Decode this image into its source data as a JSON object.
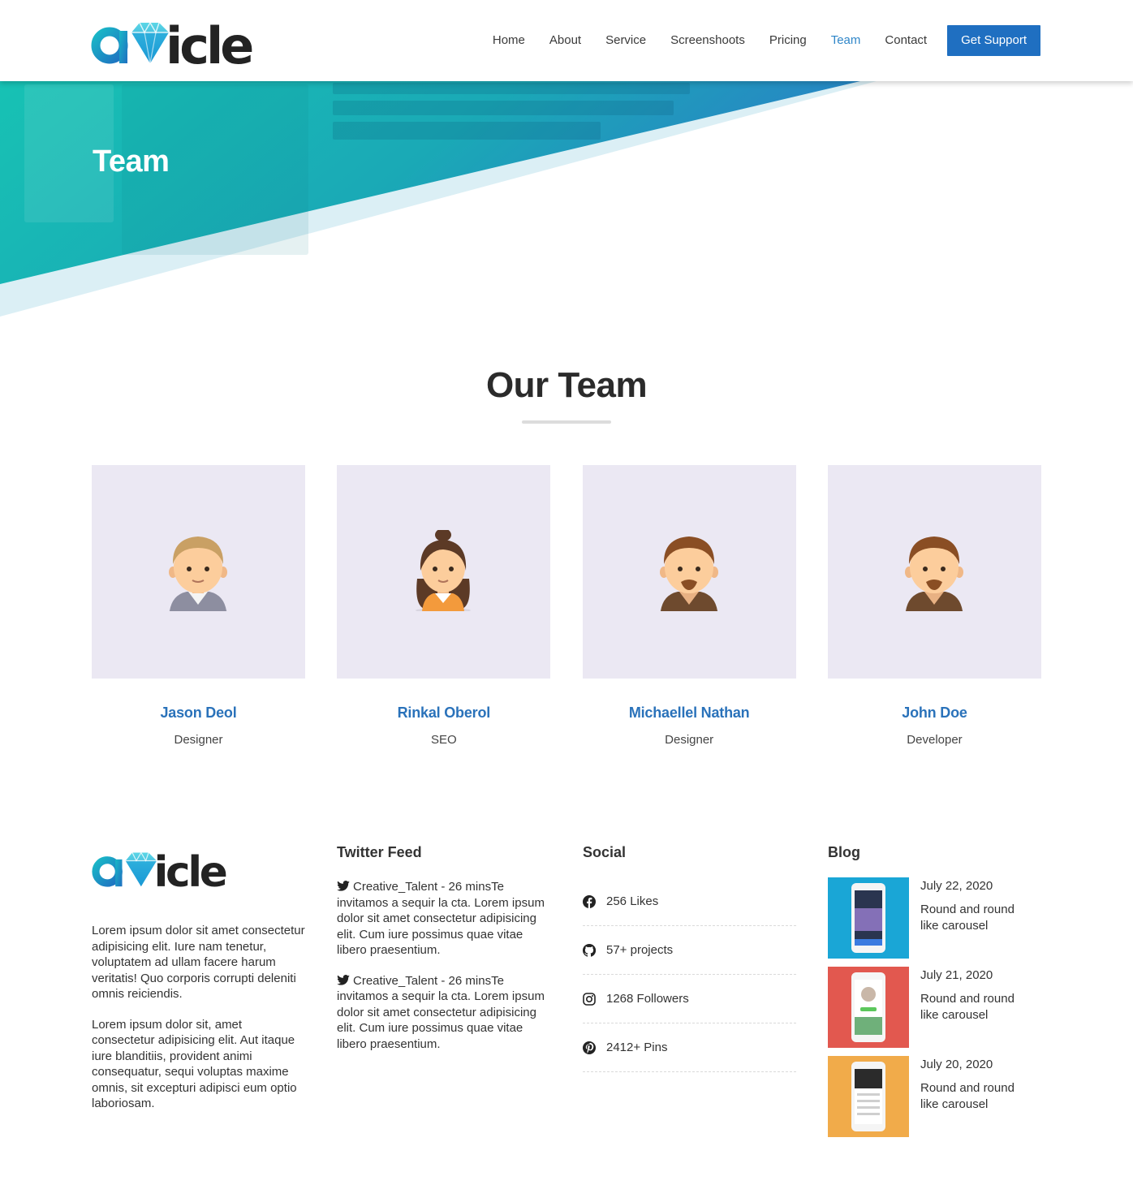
{
  "brand": {
    "logo_text": "avicle"
  },
  "nav": {
    "items": [
      {
        "label": "Home",
        "active": false
      },
      {
        "label": "About",
        "active": false
      },
      {
        "label": "Service",
        "active": false
      },
      {
        "label": "Screenshoots",
        "active": false
      },
      {
        "label": "Pricing",
        "active": false
      },
      {
        "label": "Team",
        "active": true
      },
      {
        "label": "Contact",
        "active": false
      }
    ],
    "cta": "Get Support"
  },
  "hero": {
    "title": "Team"
  },
  "section": {
    "title": "Our Team"
  },
  "team": [
    {
      "name": "Jason Deol",
      "role": "Designer",
      "avatar": "man-blond-avatar"
    },
    {
      "name": "Rinkal Oberol",
      "role": "SEO",
      "avatar": "woman-brunette-avatar"
    },
    {
      "name": "Michaellel Nathan",
      "role": "Designer",
      "avatar": "man-beard-avatar"
    },
    {
      "name": "John Doe",
      "role": "Developer",
      "avatar": "man-beard-avatar"
    }
  ],
  "footer": {
    "about": {
      "paragraph_1": "Lorem ipsum dolor sit amet consectetur adipisicing elit. Iure nam tenetur, voluptatem ad ullam facere harum veritatis! Quo corporis corrupti deleniti omnis reiciendis.",
      "paragraph_2": "Lorem ipsum dolor sit, amet consectetur adipisicing elit. Aut itaque iure blanditiis, provident animi consequatur, sequi voluptas maxime omnis, sit excepturi adipisci eum optio laboriosam."
    },
    "twitter": {
      "heading": "Twitter Feed",
      "tweets": [
        "Creative_Talent - 26 minsTe invitamos a sequir la cta. Lorem ipsum dolor sit amet consectetur adipisicing elit. Cum iure possimus quae vitae libero praesentium.",
        "Creative_Talent - 26 minsTe invitamos a sequir la cta. Lorem ipsum dolor sit amet consectetur adipisicing elit. Cum iure possimus quae vitae libero praesentium."
      ]
    },
    "social": {
      "heading": "Social",
      "items": [
        {
          "icon": "facebook-icon",
          "label": "256 Likes"
        },
        {
          "icon": "github-icon",
          "label": "57+ projects"
        },
        {
          "icon": "instagram-icon",
          "label": "1268 Followers"
        },
        {
          "icon": "pinterest-icon",
          "label": "2412+ Pins"
        }
      ]
    },
    "blog": {
      "heading": "Blog",
      "posts": [
        {
          "date": "July 22, 2020",
          "title": "Round and round like carousel",
          "color": "#1aa6d6"
        },
        {
          "date": "July 21, 2020",
          "title": "Round and round like carousel",
          "color": "#e2584f"
        },
        {
          "date": "July 20, 2020",
          "title": "Round and round like carousel",
          "color": "#f1ab4a"
        }
      ]
    }
  },
  "colors": {
    "accent": "#1f6fc1",
    "name_blue": "#2a72ba",
    "hero_teal": "#17bfb2",
    "card_bg": "#ebe8f3"
  }
}
